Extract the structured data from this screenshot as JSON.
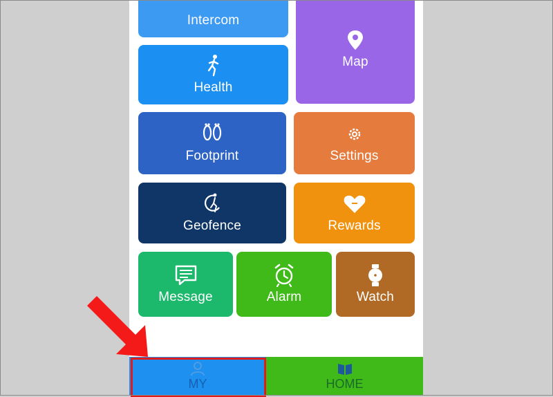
{
  "tiles": {
    "intercom": {
      "label": "Intercom",
      "color": "#3d9af2",
      "icon": "intercom-icon"
    },
    "map": {
      "label": "Map",
      "color": "#9966e8",
      "icon": "map-pin-icon"
    },
    "health": {
      "label": "Health",
      "color": "#1c8ff2",
      "icon": "running-person-icon"
    },
    "footprint": {
      "label": "Footprint",
      "color": "#2d63c4",
      "icon": "footprints-icon"
    },
    "settings": {
      "label": "Settings",
      "color": "#e57b3d",
      "icon": "gear-icon"
    },
    "geofence": {
      "label": "Geofence",
      "color": "#0f3666",
      "icon": "geofence-icon"
    },
    "rewards": {
      "label": "Rewards",
      "color": "#f0920e",
      "icon": "heart-icon"
    },
    "message": {
      "label": "Message",
      "color": "#1cb86c",
      "icon": "message-icon"
    },
    "alarm": {
      "label": "Alarm",
      "color": "#3fba18",
      "icon": "alarm-clock-icon"
    },
    "watch": {
      "label": "Watch",
      "color": "#b06a26",
      "icon": "watch-icon"
    }
  },
  "bottom_nav": {
    "my": {
      "label": "MY",
      "color": "#1e90f0",
      "text_color": "#1660b0",
      "icon": "person-icon"
    },
    "home": {
      "label": "HOME",
      "color": "#3fba18",
      "text_color": "#1a6a2a",
      "icon": "book-icon"
    }
  },
  "annotation": {
    "highlight_color": "#e01b1b",
    "arrow_color": "#f51a1a"
  }
}
